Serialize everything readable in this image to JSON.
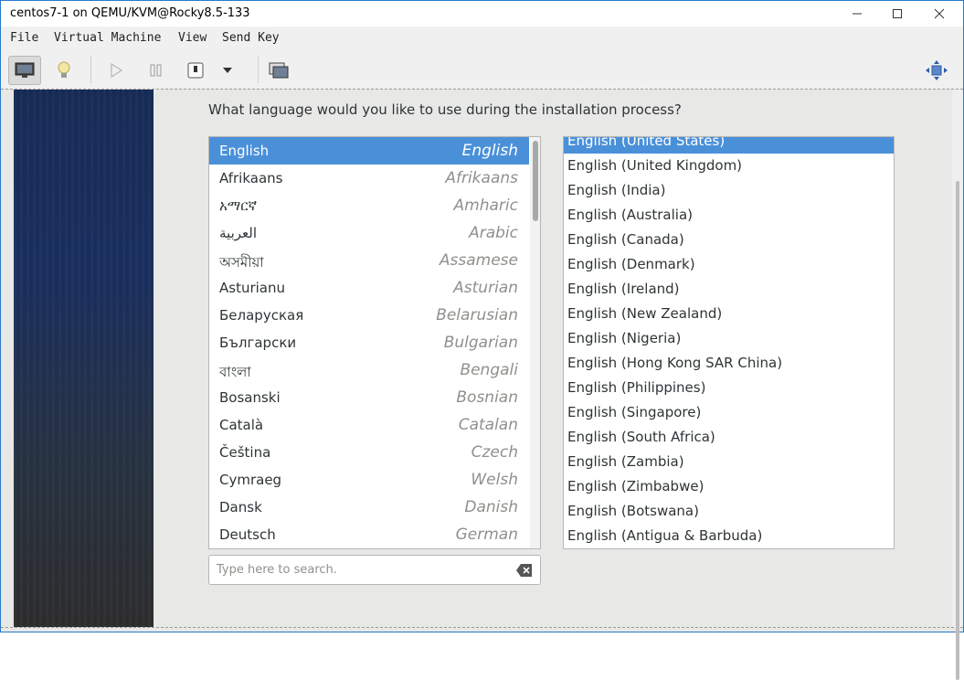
{
  "window": {
    "title": "centos7-1 on QEMU/KVM@Rocky8.5-133"
  },
  "menu": {
    "items": [
      "File",
      "Virtual Machine",
      "View",
      "Send Key"
    ]
  },
  "installer": {
    "question": "What language would you like to use during the installation process?",
    "languages": [
      {
        "native": "English",
        "english": "English",
        "selected": true
      },
      {
        "native": "Afrikaans",
        "english": "Afrikaans"
      },
      {
        "native": "አማርኛ",
        "english": "Amharic"
      },
      {
        "native": "العربية",
        "english": "Arabic"
      },
      {
        "native": "অসমীয়া",
        "english": "Assamese"
      },
      {
        "native": "Asturianu",
        "english": "Asturian"
      },
      {
        "native": "Беларуская",
        "english": "Belarusian"
      },
      {
        "native": "Български",
        "english": "Bulgarian"
      },
      {
        "native": "বাংলা",
        "english": "Bengali"
      },
      {
        "native": "Bosanski",
        "english": "Bosnian"
      },
      {
        "native": "Català",
        "english": "Catalan"
      },
      {
        "native": "Čeština",
        "english": "Czech"
      },
      {
        "native": "Cymraeg",
        "english": "Welsh"
      },
      {
        "native": "Dansk",
        "english": "Danish"
      },
      {
        "native": "Deutsch",
        "english": "German"
      }
    ],
    "locales": [
      {
        "label": "English (United States)",
        "selected": true
      },
      {
        "label": "English (United Kingdom)"
      },
      {
        "label": "English (India)"
      },
      {
        "label": "English (Australia)"
      },
      {
        "label": "English (Canada)"
      },
      {
        "label": "English (Denmark)"
      },
      {
        "label": "English (Ireland)"
      },
      {
        "label": "English (New Zealand)"
      },
      {
        "label": "English (Nigeria)"
      },
      {
        "label": "English (Hong Kong SAR China)"
      },
      {
        "label": "English (Philippines)"
      },
      {
        "label": "English (Singapore)"
      },
      {
        "label": "English (South Africa)"
      },
      {
        "label": "English (Zambia)"
      },
      {
        "label": "English (Zimbabwe)"
      },
      {
        "label": "English (Botswana)"
      },
      {
        "label": "English (Antigua & Barbuda)"
      }
    ],
    "search": {
      "placeholder": "Type here to search."
    }
  },
  "colors": {
    "selection": "#4a90d9",
    "window_border": "#2b79c9"
  }
}
